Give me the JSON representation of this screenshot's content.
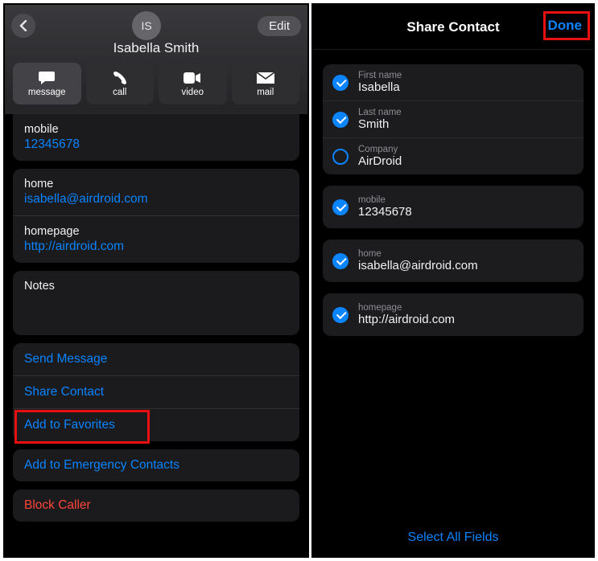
{
  "left": {
    "avatar_initials": "IS",
    "edit_label": "Edit",
    "name": "Isabella Smith",
    "actions": {
      "message": "message",
      "call": "call",
      "video": "video",
      "mail": "mail"
    },
    "fields": {
      "mobile_label": "mobile",
      "mobile_value": "12345678",
      "home_label": "home",
      "home_value": "isabella@airdroid.com",
      "homepage_label": "homepage",
      "homepage_value": "http://airdroid.com",
      "notes_label": "Notes"
    },
    "options": {
      "send_message": "Send Message",
      "share_contact": "Share Contact",
      "add_favorites": "Add to Favorites",
      "add_emergency": "Add to Emergency Contacts",
      "block_caller": "Block Caller"
    }
  },
  "right": {
    "title": "Share Contact",
    "done_label": "Done",
    "fields": {
      "first_name_label": "First name",
      "first_name_value": "Isabella",
      "last_name_label": "Last name",
      "last_name_value": "Smith",
      "company_label": "Company",
      "company_value": "AirDroid",
      "mobile_label": "mobile",
      "mobile_value": "12345678",
      "home_label": "home",
      "home_value": "isabella@airdroid.com",
      "homepage_label": "homepage",
      "homepage_value": "http://airdroid.com"
    },
    "checked": {
      "first_name": true,
      "last_name": true,
      "company": false,
      "mobile": true,
      "home": true,
      "homepage": true
    },
    "select_all": "Select All Fields"
  }
}
